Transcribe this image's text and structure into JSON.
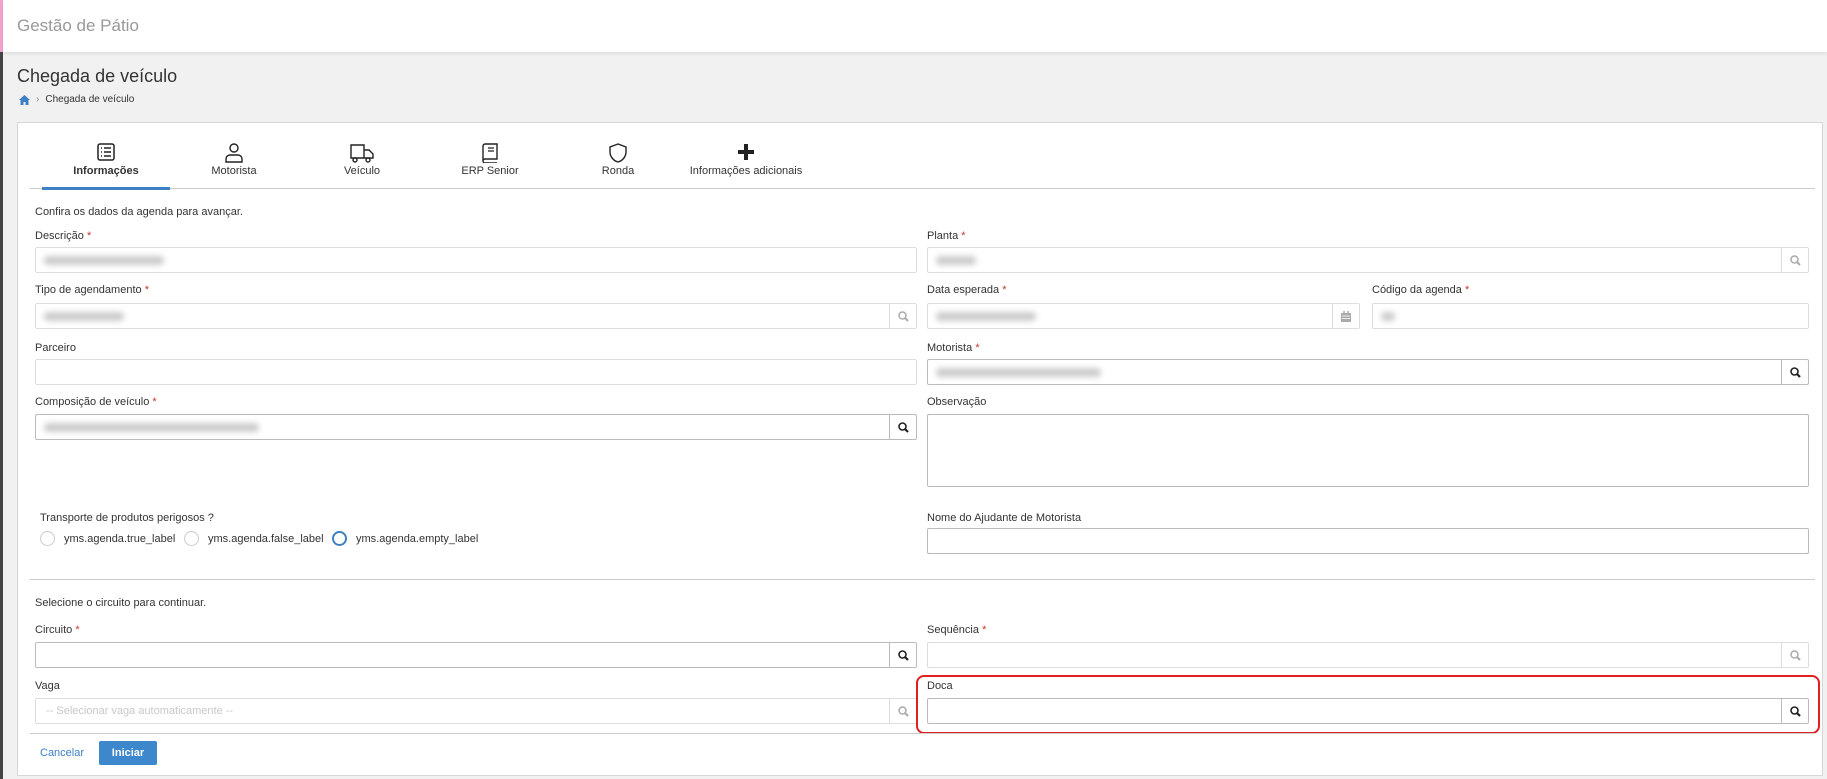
{
  "app": {
    "title": "Gestão de Pátio"
  },
  "page": {
    "title": "Chegada de veículo",
    "breadcrumb": [
      "Chegada de veículo"
    ]
  },
  "tabs": [
    {
      "label": "Informações",
      "icon": "list-icon",
      "active": true
    },
    {
      "label": "Motorista",
      "icon": "user-icon"
    },
    {
      "label": "Veículo",
      "icon": "truck-icon"
    },
    {
      "label": "ERP Senior",
      "icon": "book-icon"
    },
    {
      "label": "Ronda",
      "icon": "shield-icon"
    },
    {
      "label": "Informações adicionais",
      "icon": "plus-icon"
    }
  ],
  "form": {
    "intro": "Confira os dados da agenda para avançar.",
    "required_mark": "*",
    "descricao": {
      "label": "Descrição"
    },
    "planta": {
      "label": "Planta"
    },
    "tipo": {
      "label": "Tipo de agendamento"
    },
    "data": {
      "label": "Data esperada"
    },
    "codigo": {
      "label": "Código da agenda"
    },
    "parceiro": {
      "label": "Parceiro"
    },
    "motorista": {
      "label": "Motorista"
    },
    "composicao": {
      "label": "Composição de veículo"
    },
    "observacao": {
      "label": "Observação"
    },
    "transporte": {
      "label": "Transporte de produtos perigosos ?",
      "options": [
        "yms.agenda.true_label",
        "yms.agenda.false_label",
        "yms.agenda.empty_label"
      ]
    },
    "ajudante": {
      "label": "Nome do Ajudante de Motorista"
    }
  },
  "circuit": {
    "intro": "Selecione o circuito para continuar.",
    "circuito": {
      "label": "Circuito"
    },
    "sequencia": {
      "label": "Sequência"
    },
    "vaga": {
      "label": "Vaga",
      "placeholder": "-- Selecionar vaga automaticamente --"
    },
    "doca": {
      "label": "Doca"
    }
  },
  "actions": {
    "cancel": "Cancelar",
    "start": "Iniciar"
  },
  "colors": {
    "accent": "#3d80c3",
    "highlight": "#e02020"
  }
}
